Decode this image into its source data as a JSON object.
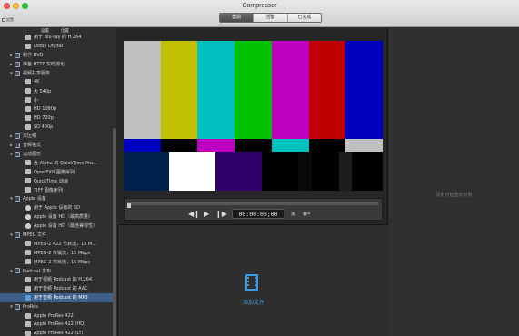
{
  "window": {
    "title": "Compressor"
  },
  "toolbar": {
    "settings_label": "設置",
    "tabs": [
      {
        "label": "當前",
        "active": true
      },
      {
        "label": "活動",
        "active": false
      },
      {
        "label": "已完成",
        "active": false
      }
    ]
  },
  "sidebar": {
    "column_headers": [
      "設置",
      "位置"
    ],
    "items": [
      {
        "label": "用于 Blu-ray 的 H.264",
        "level": 1,
        "icon": "preset-icon"
      },
      {
        "label": "Dolby Digital",
        "level": 1,
        "icon": "preset-icon"
      },
      {
        "label": "制作 DVD",
        "level": 0,
        "icon": "folder-icon"
      },
      {
        "label": "准备 HTTP 实时流化",
        "level": 0,
        "icon": "folder-icon"
      },
      {
        "label": "视频共享服务",
        "level": 0,
        "icon": "folder-icon",
        "expanded": true
      },
      {
        "label": "4K",
        "level": 1,
        "icon": "preset-icon"
      },
      {
        "label": "大 540p",
        "level": 1,
        "icon": "preset-icon"
      },
      {
        "label": "小",
        "level": 1,
        "icon": "preset-icon"
      },
      {
        "label": "HD 1080p",
        "level": 1,
        "icon": "preset-icon"
      },
      {
        "label": "HD 720p",
        "level": 1,
        "icon": "preset-icon"
      },
      {
        "label": "SD 480p",
        "level": 1,
        "icon": "preset-icon"
      },
      {
        "label": "未压缩",
        "level": 0,
        "icon": "folder-icon"
      },
      {
        "label": "音频格式",
        "level": 0,
        "icon": "folder-icon"
      },
      {
        "label": "运动图形",
        "level": 0,
        "icon": "folder-icon",
        "expanded": true
      },
      {
        "label": "含 Alpha 的 QuickTime Pro...",
        "level": 1,
        "icon": "preset-icon"
      },
      {
        "label": "OpenEXR 图像序列",
        "level": 1,
        "icon": "preset-icon"
      },
      {
        "label": "QuickTime 动画",
        "level": 1,
        "icon": "preset-icon"
      },
      {
        "label": "TIFF 图像序列",
        "level": 1,
        "icon": "preset-icon"
      },
      {
        "label": "Apple 设备",
        "level": 0,
        "icon": "folder-icon",
        "expanded": true
      },
      {
        "label": "用于 Apple 设备的 SD",
        "level": 1,
        "icon": "apple-icon"
      },
      {
        "label": "Apple 设备 HD（最高质量）",
        "level": 1,
        "icon": "apple-icon"
      },
      {
        "label": "Apple 设备 HD（最佳兼容性）",
        "level": 1,
        "icon": "apple-icon"
      },
      {
        "label": "MPEG 文件",
        "level": 0,
        "icon": "folder-icon",
        "expanded": true
      },
      {
        "label": "MPEG-2 422 节目流，15 M...",
        "level": 1,
        "icon": "preset-icon"
      },
      {
        "label": "MPEG-2 传输流，15 Mbps",
        "level": 1,
        "icon": "preset-icon"
      },
      {
        "label": "MPEG-2 节目流，15 Mbps",
        "level": 1,
        "icon": "preset-icon"
      },
      {
        "label": "Podcast 发布",
        "level": 0,
        "icon": "folder-icon",
        "expanded": true
      },
      {
        "label": "用于视频 Podcast 的 H.264",
        "level": 1,
        "icon": "preset-icon"
      },
      {
        "label": "用于音频 Podcast 的 AAC",
        "level": 1,
        "icon": "preset-icon"
      },
      {
        "label": "用于音频 Podcast 的 MP3",
        "level": 1,
        "icon": "blue-icon",
        "selected": true
      },
      {
        "label": "ProRes",
        "level": 0,
        "icon": "folder-icon",
        "expanded": true
      },
      {
        "label": "Apple ProRes 422",
        "level": 1,
        "icon": "preset-icon"
      },
      {
        "label": "Apple ProRes 422 (HQ)",
        "level": 1,
        "icon": "preset-icon"
      },
      {
        "label": "Apple ProRes 422 (LT)",
        "level": 1,
        "icon": "preset-icon"
      },
      {
        "label": "Apple ProRes 422 (Proxy)",
        "level": 1,
        "icon": "preset-icon"
      }
    ]
  },
  "preview": {
    "colors": {
      "top_bars": [
        "#c0c0c0",
        "#c0c000",
        "#00c0c0",
        "#00c000",
        "#c000c0",
        "#c00000",
        "#0000c0"
      ],
      "mid_bars": [
        "#0000c0",
        "#000000",
        "#c000c0",
        "#000000",
        "#00c0c0",
        "#000000",
        "#c0c0c0"
      ],
      "bottom_bars": [
        "#00214c",
        "#ffffff",
        "#32006a",
        "#000000",
        "#090909",
        "#000000",
        "#1d1d1d",
        "#000000"
      ]
    }
  },
  "transport": {
    "timecode": "00:00:00;00"
  },
  "main": {
    "add_file_label": "添加文件"
  },
  "inspector": {
    "empty_text": "没有可检查的对象"
  }
}
